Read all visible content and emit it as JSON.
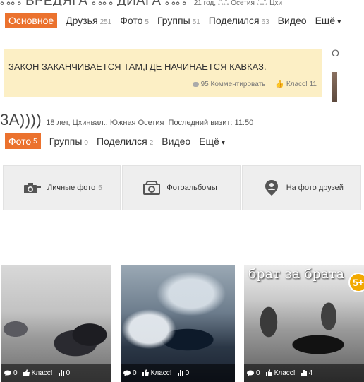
{
  "header": {
    "name_fragment": "ஃஃ ВРЕДЯГА ஃஃ ДИАГА ஃஃ",
    "info_fragment": "21 год, ஃஃ Осетия ஃஃ Цхи"
  },
  "nav_top": {
    "items": [
      {
        "label": "Основное",
        "count": ""
      },
      {
        "label": "Друзья",
        "count": "251"
      },
      {
        "label": "Фото",
        "count": "5"
      },
      {
        "label": "Группы",
        "count": "51"
      },
      {
        "label": "Поделился",
        "count": "63"
      },
      {
        "label": "Видео",
        "count": ""
      },
      {
        "label": "Ещё",
        "count": ""
      }
    ]
  },
  "status": {
    "text": "ЗАКОН ЗАКАНЧИВАЕТСЯ ТАМ,ГДЕ НАЧИНАЕТСЯ КАВКАЗ.",
    "comments_count": "95",
    "comment_label": "Комментировать",
    "like_label": "Класс!",
    "like_count": "11"
  },
  "side_fragment": {
    "letter": "О"
  },
  "profile": {
    "name_fragment": "3А))))",
    "info": "18 лет, Цхинвал., Южная Осетия",
    "last_visit": "Последний визит: 11:50"
  },
  "nav_second": {
    "items": [
      {
        "label": "Фото",
        "count": "5"
      },
      {
        "label": "Группы",
        "count": "0"
      },
      {
        "label": "Поделился",
        "count": "2"
      },
      {
        "label": "Видео",
        "count": ""
      },
      {
        "label": "Ещё",
        "count": ""
      }
    ]
  },
  "photo_tabs": [
    {
      "label": "Личные фото",
      "count": "5",
      "icon": "camera-icon"
    },
    {
      "label": "Фотоальбомы",
      "count": "",
      "icon": "album-icon"
    },
    {
      "label": "На фото друзей",
      "count": "",
      "icon": "pin-person-icon"
    }
  ],
  "photos": [
    {
      "comments": "0",
      "like_label": "Класс!",
      "views": "0"
    },
    {
      "comments": "0",
      "like_label": "Класс!",
      "views": "0"
    },
    {
      "comments": "0",
      "like_label": "Класс!",
      "views": "4",
      "overlay_title": "брат за брата",
      "badge": "5+"
    }
  ],
  "colors": {
    "accent": "#eb722e",
    "status_bg": "#fcefc5",
    "tab_bg": "#eeeeee"
  }
}
